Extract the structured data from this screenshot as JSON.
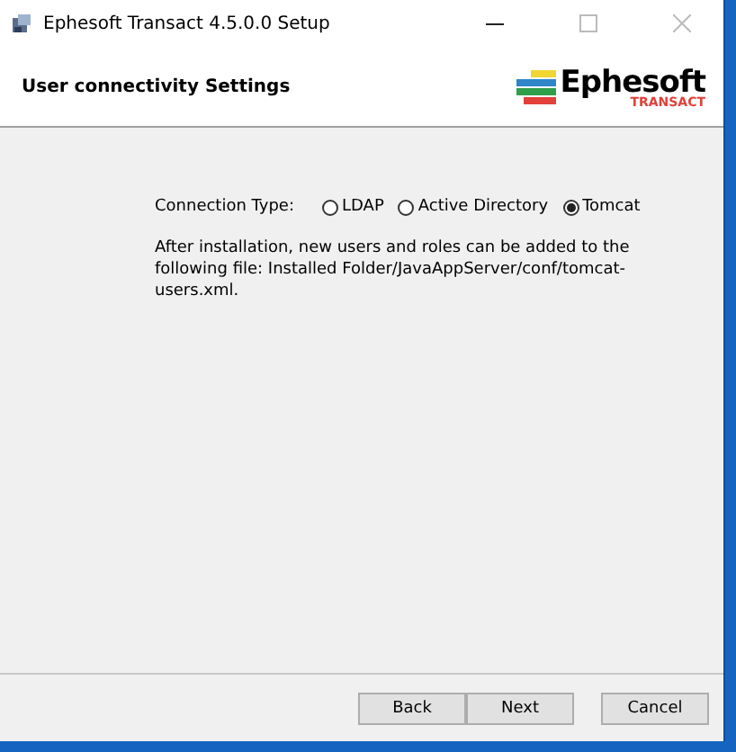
{
  "window": {
    "title": "Ephesoft Transact 4.5.0.0 Setup"
  },
  "header": {
    "title": "User connectivity Settings",
    "logo": {
      "name": "Ephesoft",
      "tagline": "TRANSACT"
    }
  },
  "connection": {
    "label": "Connection Type:",
    "options": [
      {
        "label": "LDAP",
        "selected": false
      },
      {
        "label": "Active Directory",
        "selected": false
      },
      {
        "label": "Tomcat",
        "selected": true
      }
    ]
  },
  "note": "After installation, new users and roles can be added to the following file: Installed Folder/JavaAppServer/conf/tomcat-users.xml.",
  "buttons": [
    {
      "label": "Back",
      "kind": "nav"
    },
    {
      "label": "Next",
      "kind": "nav"
    },
    {
      "label": "Cancel",
      "kind": "cancel"
    }
  ]
}
